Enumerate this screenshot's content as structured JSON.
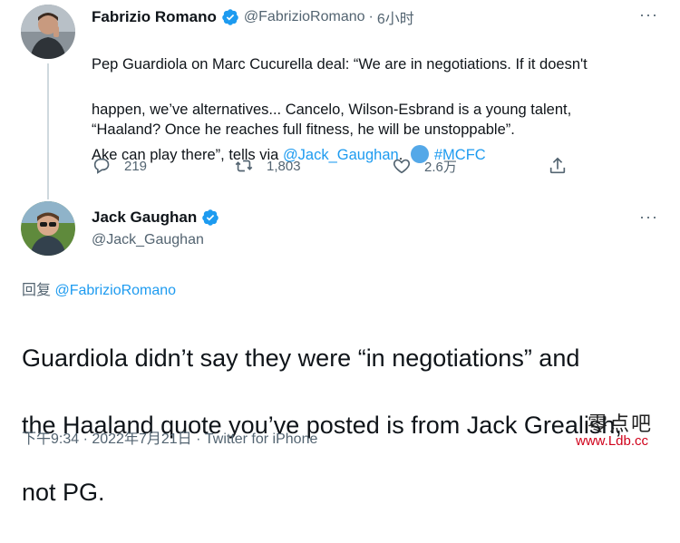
{
  "tweet1": {
    "author_name": "Fabrizio Romano",
    "handle": "@FabrizioRomano",
    "separator": "·",
    "time": "6小时",
    "more": "···",
    "text_line1": "Pep Guardiola on Marc Cucurella deal: “We are in negotiations. If it doesn't",
    "text_line2": "happen, we’ve alternatives... Cancelo, Wilson-Esbrand is a young talent,",
    "text_line3": "Ake can play there”, tells via ",
    "mention": "@Jack_Gaughan",
    "text_after_mention": ". ",
    "hashtag": "#MCFC",
    "text_line4": "“Haaland? Once he reaches full fitness, he will be unstoppable”.",
    "replies": "219",
    "retweets": "1,803",
    "likes": "2.6万"
  },
  "tweet2": {
    "author_name": "Jack Gaughan",
    "handle": "@Jack_Gaughan",
    "more": "···",
    "reply_prefix": "回复 ",
    "reply_to": "@FabrizioRomano",
    "text_line1": "Guardiola didn’t say they were “in negotiations” and",
    "text_line2": "the Haaland quote you’ve posted is from Jack Grealish,",
    "text_line3": "not PG.",
    "timestamp": "下午9:34 · 2022年7月21日 · Twitter for iPhone"
  },
  "watermark": {
    "line1": "零点吧",
    "line2": "www.Ldb.cc"
  },
  "colors": {
    "accent": "#1d9bf0",
    "text": "#0f1419",
    "secondary": "#536471",
    "watermark_url": "#d0021b"
  }
}
